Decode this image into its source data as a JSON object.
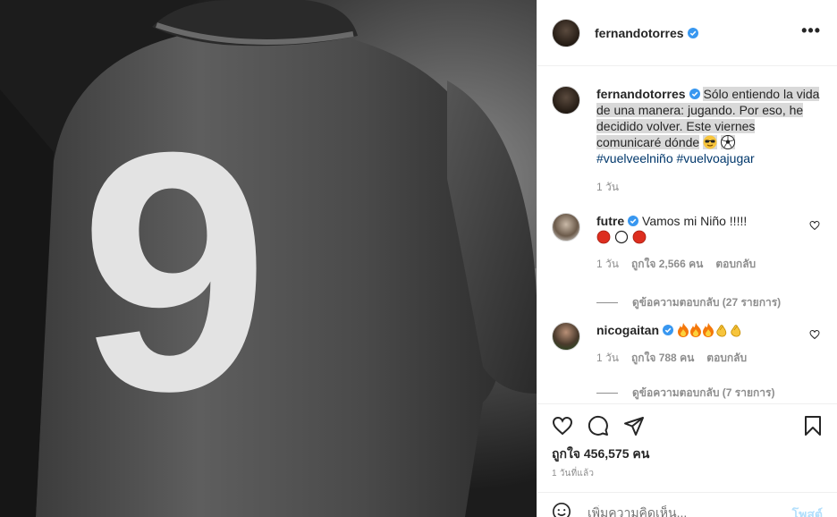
{
  "post": {
    "jersey_number": "9",
    "author": "fernandotorres",
    "more_glyph": "•••",
    "caption": {
      "username": "fernandotorres",
      "text": "Sólo entiendo la vida de una manera: jugando. Por eso, he decidido volver. Este viernes comunicaré dónde",
      "hashtag1": "#vuelveelniño",
      "hashtag2": "#vuelvoajugar",
      "time": "1 วัน"
    },
    "comments": [
      {
        "username": "futre",
        "text": "Vamos mi Niño !!!!!",
        "time": "1 วัน",
        "likes": "ถูกใจ 2,566 คน",
        "reply": "ตอบกลับ",
        "view_replies": "ดูข้อความตอบกลับ (27 รายการ)"
      },
      {
        "username": "nicogaitan",
        "time": "1 วัน",
        "likes": "ถูกใจ 788 คน",
        "reply": "ตอบกลับ",
        "view_replies": "ดูข้อความตอบกลับ (7 รายการ)"
      }
    ],
    "like_count": "ถูกใจ 456,575 คน",
    "posted_ago": "1 วันที่แล้ว",
    "add_comment_placeholder": "เพิ่มความคิดเห็น...",
    "post_button": "โพสต์"
  },
  "colors": {
    "verified": "#3897f0",
    "link": "#00376b",
    "muted": "#8e8e8e",
    "post_button_disabled": "#b2dffc"
  }
}
